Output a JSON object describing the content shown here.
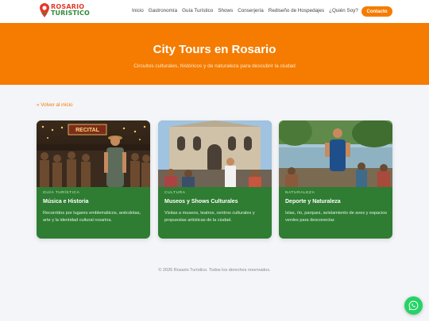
{
  "brand": {
    "line1": "ROSARIO",
    "line2": "TURISTICO"
  },
  "nav": [
    "Inicio",
    "Gastronomía",
    "Guía Turístico",
    "Shows",
    "Conserjería",
    "Rediseño de Hospedajes",
    "¿Quién Soy?"
  ],
  "contact_label": "Contacto",
  "hero": {
    "title": "City Tours en Rosario",
    "subtitle": "Circuitos culturales, históricos y de naturaleza para descubrir la ciudad"
  },
  "back_link": "« Volver al inicio",
  "cards": [
    {
      "category": "Guía Turística",
      "title": "Música e Historia",
      "description": "Recorridos por lugares emblemáticos, anécdotas, arte y la identidad cultural rosarina.",
      "image_badge": "RECITAL"
    },
    {
      "category": "Cultura",
      "title": "Museos y Shows Culturales",
      "description": "Visitas a museos, teatros, centros culturales y propuestas artísticas de la ciudad."
    },
    {
      "category": "Naturaleza",
      "title": "Deporte y Naturaleza",
      "description": "Islas, río, parques, avistamiento de aves y espacios verdes para desconectar."
    }
  ],
  "footer": "© 2026 Rosario Turístico. Todos los derechos reservados.",
  "colors": {
    "accent": "#f57c00",
    "card_green": "#2e7d32",
    "whatsapp": "#25d366"
  },
  "icons": [
    "map-pin-icon",
    "whatsapp-icon"
  ]
}
